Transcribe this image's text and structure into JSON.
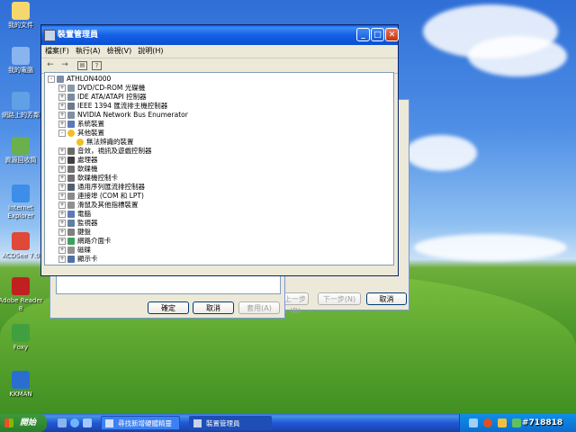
{
  "desktop_icons": [
    {
      "label": "我的文件",
      "icon": "my-documents-icon"
    },
    {
      "label": "我的電腦",
      "icon": "my-computer-icon"
    },
    {
      "label": "網路上的芳鄰",
      "icon": "network-icon"
    },
    {
      "label": "資源回收筒",
      "icon": "recycle-bin-icon"
    },
    {
      "label": "Internet Explorer",
      "icon": "ie-icon"
    },
    {
      "label": "ACDSee 7.0",
      "icon": "acdsee-icon"
    },
    {
      "label": "Adobe Reader 8",
      "icon": "adobe-reader-icon"
    },
    {
      "label": "Foxy",
      "icon": "foxy-icon"
    },
    {
      "label": "KKMAN",
      "icon": "kkman-icon"
    }
  ],
  "device_manager": {
    "title": "裝置管理員",
    "menu": [
      "檔案(F)",
      "執行(A)",
      "檢視(V)",
      "說明(H)"
    ],
    "tree": {
      "root": "ATHLON4000",
      "items": [
        {
          "label": "DVD/CD-ROM 光碟機",
          "expander": "+"
        },
        {
          "label": "IDE ATA/ATAPI 控制器",
          "expander": "+"
        },
        {
          "label": "IEEE 1394 匯流排主機控制器",
          "expander": "+"
        },
        {
          "label": "NVIDIA Network Bus Enumerator",
          "expander": "+"
        },
        {
          "label": "系統裝置",
          "expander": "+"
        },
        {
          "label": "其他裝置",
          "expander": "-"
        },
        {
          "label": "無法辨識的裝置",
          "child": true
        },
        {
          "label": "音效，視訊及遊戲控制器",
          "expander": "+"
        },
        {
          "label": "處理器",
          "expander": "+"
        },
        {
          "label": "軟碟機",
          "expander": "+"
        },
        {
          "label": "軟碟機控制卡",
          "expander": "+"
        },
        {
          "label": "通用序列匯流排控制器",
          "expander": "+"
        },
        {
          "label": "連接埠 (COM 和 LPT)",
          "expander": "+"
        },
        {
          "label": "滑鼠及其他指標裝置",
          "expander": "+"
        },
        {
          "label": "電腦",
          "expander": "+"
        },
        {
          "label": "監視器",
          "expander": "+"
        },
        {
          "label": "鍵盤",
          "expander": "+"
        },
        {
          "label": "網路介面卡",
          "expander": "+"
        },
        {
          "label": "磁碟",
          "expander": "+"
        },
        {
          "label": "顯示卡",
          "expander": "+"
        }
      ]
    }
  },
  "back_dialog": {
    "ok": "確定",
    "cancel": "取消",
    "apply": "套用(A)"
  },
  "wizard": {
    "back": "上一步(B)",
    "next": "下一步(N)",
    "cancel": "取消"
  },
  "taskbar": {
    "start": "開始",
    "tasks": [
      "尋找新增硬體精靈",
      "裝置管理員"
    ]
  },
  "watermark": "#718818",
  "colors": {
    "titlebar": "#0a5ae0",
    "taskbar": "#2157d7",
    "start": "#2b7d2b"
  }
}
